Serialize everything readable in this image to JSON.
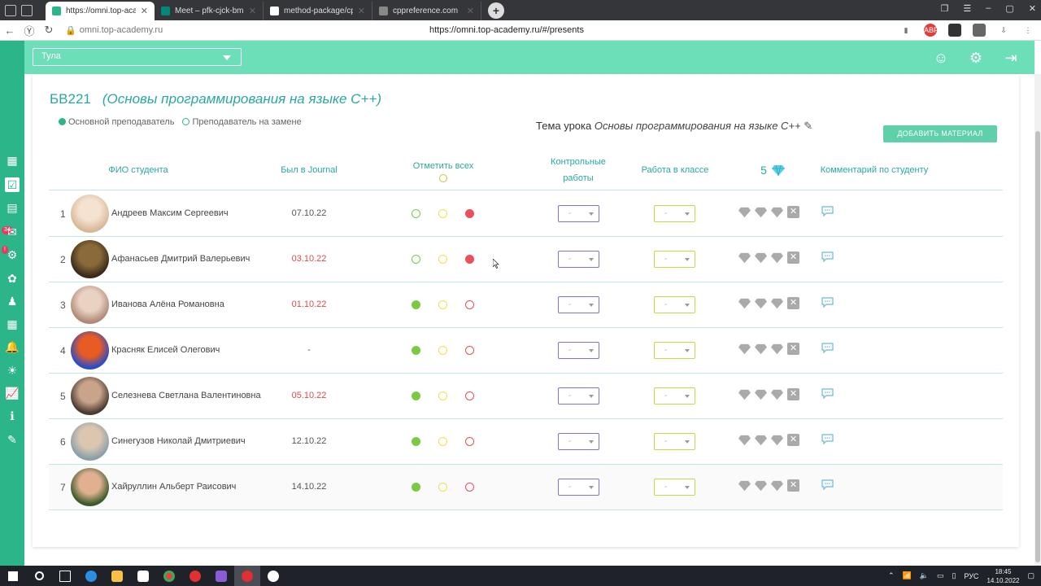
{
  "browser": {
    "tabs": [
      {
        "label": "https://omni.top-academ",
        "active": true,
        "color": "#2db58a"
      },
      {
        "label": "Meet – pfk-cjck-bma",
        "active": false,
        "color": "#00897b"
      },
      {
        "label": "method-package/cpp plan",
        "active": false,
        "color": "#ffffff"
      },
      {
        "label": "cppreference.com",
        "active": false,
        "color": "#888888"
      }
    ],
    "address_left": "omni.top-academy.ru",
    "address_center": "https://omni.top-academy.ru/#/presents"
  },
  "header": {
    "city": "Тула"
  },
  "group": {
    "code": "БВ221",
    "subject": "(Основы программирования на языке С++)"
  },
  "legend": {
    "main_teacher": "Основной преподаватель",
    "substitute_teacher": "Преподаватель на замене"
  },
  "topic": {
    "label": "Тема урока",
    "value": "Основы программирования на языке С++"
  },
  "add_material_label": "ДОБАВИТЬ МАТЕРИАЛ",
  "table": {
    "headers": {
      "name": "ФИО студента",
      "journal": "Был в Journal",
      "mark_all": "Отметить всех",
      "tests_1": "Контрольные",
      "tests_2": "работы",
      "classwork": "Работа в классе",
      "gems": "5",
      "comment": "Комментарий по студенту"
    },
    "rows": [
      {
        "num": "1",
        "name": "Андреев Максим Сергеевич",
        "date": "07.10.22",
        "date_red": false,
        "attendance": "absent",
        "tests": "-",
        "classwork": "-"
      },
      {
        "num": "2",
        "name": "Афанасьев Дмитрий Валерьевич",
        "date": "03.10.22",
        "date_red": true,
        "attendance": "absent",
        "tests": "-",
        "classwork": "-"
      },
      {
        "num": "3",
        "name": "Иванова Алёна Романовна",
        "date": "01.10.22",
        "date_red": true,
        "attendance": "present",
        "tests": "-",
        "classwork": "-"
      },
      {
        "num": "4",
        "name": "Красняк Елисей Олегович",
        "date": "-",
        "date_red": false,
        "attendance": "present",
        "tests": "-",
        "classwork": "-"
      },
      {
        "num": "5",
        "name": "Селезнева Светлана Валентиновна",
        "date": "05.10.22",
        "date_red": true,
        "attendance": "present",
        "tests": "-",
        "classwork": "-"
      },
      {
        "num": "6",
        "name": "Синегузов Николай Дмитриевич",
        "date": "12.10.22",
        "date_red": false,
        "attendance": "present",
        "tests": "-",
        "classwork": "-"
      },
      {
        "num": "7",
        "name": "Хайруллин Альберт Раисович",
        "date": "14.10.22",
        "date_red": false,
        "attendance": "present",
        "tests": "-",
        "classwork": "-"
      }
    ]
  },
  "colors": {
    "accent": "#2aa7a0",
    "header_bg": "#6ddfb8",
    "sidebar_bg": "#2db58a",
    "present": "#7ac943",
    "late": "#f0e04a",
    "absent": "#e8505b",
    "tests_border": "#8a6fd6",
    "classwork_border": "#c6d84a"
  },
  "taskbar": {
    "lang": "РУС",
    "time": "18:45",
    "date": "14.10.2022"
  }
}
